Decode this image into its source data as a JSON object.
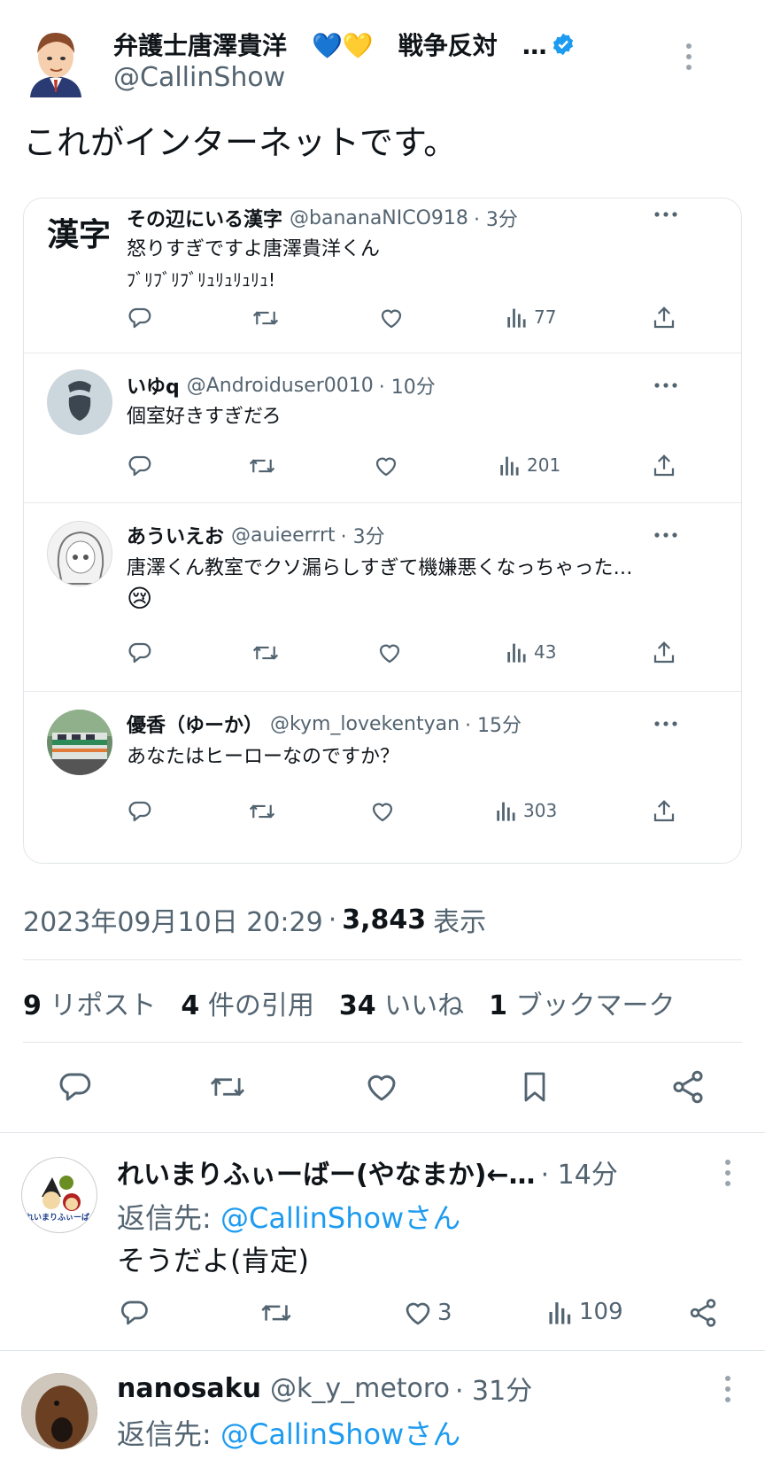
{
  "tweet": {
    "display_name": "弁護士唐澤貴洋　💙💛　戦争反対　…",
    "handle": "@CallinShow",
    "text": "これがインターネットです。",
    "timestamp": "2023年09月10日 20:29",
    "separator": "·",
    "views": "3,843",
    "views_label": "表示"
  },
  "quotes": [
    {
      "name": "その辺にいる漢字",
      "handle": "@bananaNICO918",
      "time": "· 3分",
      "avatar_text": "漢字",
      "lines": [
        "怒りすぎですよ唐澤貴洋くん",
        "ﾌﾞﾘﾌﾞﾘﾌﾞﾘｭﾘｭﾘｭﾘｭ!"
      ],
      "views": "77"
    },
    {
      "name": "いゆq",
      "handle": "@Androiduser0010",
      "time": "· 10分",
      "lines": [
        "個室好きすぎだろ"
      ],
      "views": "201"
    },
    {
      "name": "あういえお",
      "handle": "@auieerrrt",
      "time": "· 3分",
      "lines": [
        "唐澤くん教室でクソ漏らしすぎて機嫌悪くなっちゃった…",
        "😢"
      ],
      "views": "43"
    },
    {
      "name": "優香（ゆーか）",
      "handle": "@kym_lovekentyan",
      "time": "· 15分",
      "lines": [
        "あなたはヒーローなのですか？"
      ],
      "views": "303"
    }
  ],
  "stats": [
    {
      "count": "9",
      "label": "リポスト"
    },
    {
      "count": "4",
      "label": "件の引用"
    },
    {
      "count": "34",
      "label": "いいね"
    },
    {
      "count": "1",
      "label": "ブックマーク"
    }
  ],
  "replies": [
    {
      "name": "れいまりふぃーばー(やなまか)←…",
      "handle": "",
      "time": "· 14分",
      "reply_to_prefix": "返信先: ",
      "reply_to": "@CallinShowさん",
      "text": "そうだよ(肯定)",
      "avatar_text": "れいまりふぃーばー",
      "likes": "3",
      "views": "109"
    },
    {
      "name": "nanosaku",
      "handle": "@k_y_metoro",
      "time": "· 31分",
      "reply_to_prefix": "返信先: ",
      "reply_to": "@CallinShowさん"
    }
  ],
  "icons": [
    "verified-badge-icon",
    "more-icon",
    "reply-icon",
    "retweet-icon",
    "like-icon",
    "views-icon",
    "share-icon",
    "bookmark-icon"
  ],
  "colors": {
    "accent": "#1d9bf0",
    "text": "#0f1419",
    "muted": "#536471",
    "border": "#e1e6ea"
  }
}
